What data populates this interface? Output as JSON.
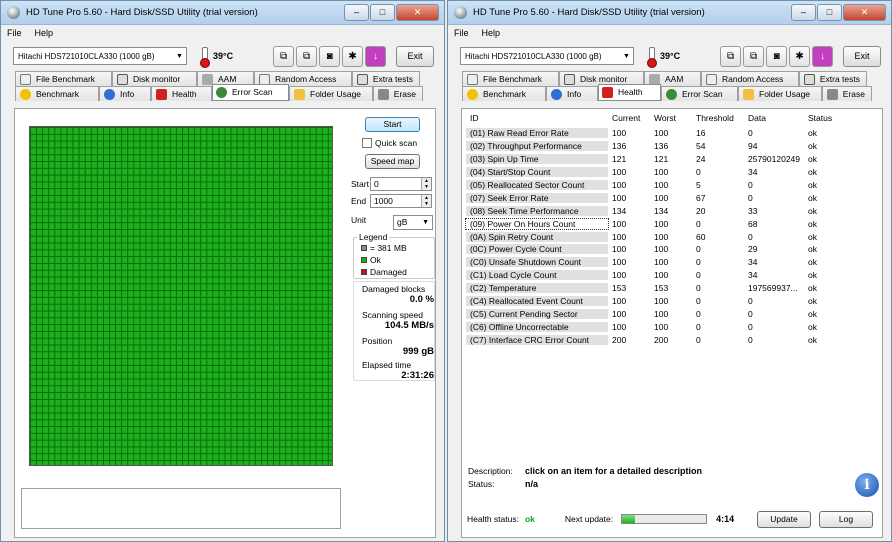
{
  "app": {
    "title": "HD Tune Pro 5.60 - Hard Disk/SSD Utility (trial version)"
  },
  "menu": {
    "file": "File",
    "help": "Help"
  },
  "toolbar": {
    "drive": "Hitachi HDS721010CLA330 (1000 gB)",
    "temperature": "39°C",
    "exit": "Exit"
  },
  "tabs_top": [
    "File Benchmark",
    "Disk monitor",
    "AAM",
    "Random Access",
    "Extra tests"
  ],
  "tabs_bottom": [
    "Benchmark",
    "Info",
    "Health",
    "Error Scan",
    "Folder Usage",
    "Erase"
  ],
  "error_scan": {
    "start_button": "Start",
    "quick_scan": "Quick scan",
    "speed_map": "Speed map",
    "start_label": "Start",
    "start_value": "0",
    "end_label": "End",
    "end_value": "1000",
    "unit_label": "Unit",
    "unit_value": "gB",
    "legend_title": "Legend",
    "legend_block": "= 381 MB",
    "legend_ok": "Ok",
    "legend_damaged": "Damaged",
    "damaged_label": "Damaged blocks",
    "damaged_value": "0.0 %",
    "speed_label": "Scanning speed",
    "speed_value": "104.5 MB/s",
    "position_label": "Position",
    "position_value": "999 gB",
    "elapsed_label": "Elapsed time",
    "elapsed_value": "2:31:26",
    "colors": {
      "ok": "#1db11d",
      "damaged": "#cc1111"
    }
  },
  "health": {
    "columns": [
      "ID",
      "Current",
      "Worst",
      "Threshold",
      "Data",
      "Status"
    ],
    "rows": [
      [
        "(01) Raw Read Error Rate",
        "100",
        "100",
        "16",
        "0",
        "ok"
      ],
      [
        "(02) Throughput Performance",
        "136",
        "136",
        "54",
        "94",
        "ok"
      ],
      [
        "(03) Spin Up Time",
        "121",
        "121",
        "24",
        "25790120249",
        "ok"
      ],
      [
        "(04) Start/Stop Count",
        "100",
        "100",
        "0",
        "34",
        "ok"
      ],
      [
        "(05) Reallocated Sector Count",
        "100",
        "100",
        "5",
        "0",
        "ok"
      ],
      [
        "(07) Seek Error Rate",
        "100",
        "100",
        "67",
        "0",
        "ok"
      ],
      [
        "(08) Seek Time Performance",
        "134",
        "134",
        "20",
        "33",
        "ok"
      ],
      [
        "(09) Power On Hours Count",
        "100",
        "100",
        "0",
        "68",
        "ok"
      ],
      [
        "(0A) Spin Retry Count",
        "100",
        "100",
        "60",
        "0",
        "ok"
      ],
      [
        "(0C) Power Cycle Count",
        "100",
        "100",
        "0",
        "29",
        "ok"
      ],
      [
        "(C0) Unsafe Shutdown Count",
        "100",
        "100",
        "0",
        "34",
        "ok"
      ],
      [
        "(C1) Load Cycle Count",
        "100",
        "100",
        "0",
        "34",
        "ok"
      ],
      [
        "(C2) Temperature",
        "153",
        "153",
        "0",
        "197569937...",
        "ok"
      ],
      [
        "(C4) Reallocated Event Count",
        "100",
        "100",
        "0",
        "0",
        "ok"
      ],
      [
        "(C5) Current Pending Sector",
        "100",
        "100",
        "0",
        "0",
        "ok"
      ],
      [
        "(C6) Offline Uncorrectable",
        "100",
        "100",
        "0",
        "0",
        "ok"
      ],
      [
        "(C7) Interface CRC Error Count",
        "200",
        "200",
        "0",
        "0",
        "ok"
      ]
    ],
    "description_label": "Description:",
    "description_value": "click on an item for a detailed description",
    "status_label": "Status:",
    "status_value": "n/a",
    "health_status_label": "Health status:",
    "health_status_value": "ok",
    "next_update_label": "Next update:",
    "next_update_value": "4:14",
    "next_update_progress": 0.15,
    "update_button": "Update",
    "log_button": "Log"
  }
}
